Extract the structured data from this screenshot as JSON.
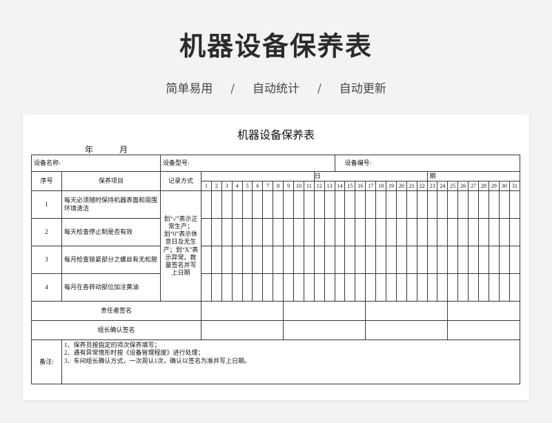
{
  "hero": {
    "title": "机器设备保养表",
    "features": [
      "简单易用",
      "自动统计",
      "自动更新"
    ],
    "separator": "/"
  },
  "sheet": {
    "title": "机器设备保养表",
    "year_label": "年",
    "month_label": "月",
    "device_name_label": "设备名称:",
    "device_model_label": "设备型号:",
    "device_no_label": "设备编号:",
    "col_seq": "序号",
    "col_item": "保养项目",
    "col_method": "记录方式",
    "day_char_1": "日",
    "day_char_2": "期",
    "days": [
      "1",
      "2",
      "3",
      "4",
      "5",
      "6",
      "7",
      "8",
      "9",
      "10",
      "11",
      "12",
      "13",
      "14",
      "15",
      "16",
      "17",
      "18",
      "19",
      "20",
      "21",
      "22",
      "23",
      "24",
      "25",
      "26",
      "27",
      "28",
      "29",
      "30",
      "31"
    ],
    "items": [
      {
        "seq": "1",
        "text": "每天必须随时保持机器表面和周围环境清洁"
      },
      {
        "seq": "2",
        "text": "每天检查停止制是否有效"
      },
      {
        "seq": "3",
        "text": "每月检查锁紧部分之螺丝有无松脱"
      },
      {
        "seq": "4",
        "text": "每月在各转动部位加注黄油"
      }
    ],
    "method_text": "划“√”表示正常生产；划“0”表示休息日及无生产；划“X”表示异常。数量签名并写上日期",
    "responsible_sign": "责任者签名",
    "leader_sign": "组长确认签名",
    "notes_label": "备注:",
    "notes": [
      "1、保养员按指定的项次保养填写；",
      "2、遇有异常情形时按《设备管理程度》进行处理；",
      "3、车间组长确认方式，一次周认1次，确认以签名为准并写上日期。"
    ]
  }
}
